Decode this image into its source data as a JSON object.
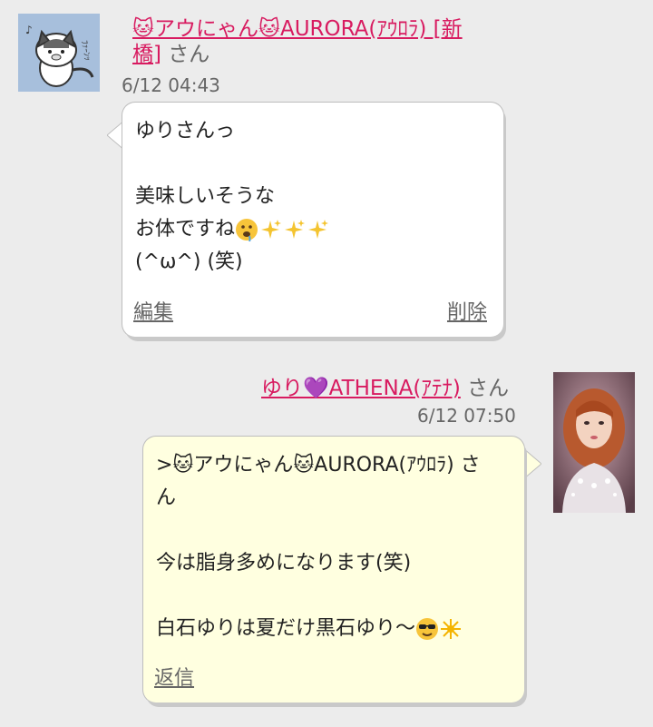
{
  "messages": [
    {
      "sender_name": "🐱アウにゃん🐱AURORA(ｱｳﾛﾗ) [新橋]",
      "sender_suffix": "さん",
      "timestamp": "6/12 04:43",
      "body_lines": [
        "ゆりさんっ",
        "",
        "美味しいそうな",
        "お体ですね",
        "(^ω^) (笑)"
      ],
      "inline_emojis": [
        "drooling-face",
        "sparkles",
        "sparkles",
        "sparkles"
      ],
      "actions": {
        "edit": "編集",
        "delete": "削除"
      }
    },
    {
      "sender_name": "ゆり💜ATHENA(ｱﾃﾅ)",
      "sender_suffix": "さん",
      "timestamp": "6/12 07:50",
      "body_lines": [
        ">🐱アウにゃん🐱AURORA(ｱｳﾛﾗ) さ",
        "ん",
        "",
        "今は脂身多めになります(笑)",
        "",
        "白石ゆりは夏だけ黒石ゆり〜"
      ],
      "inline_emojis": [
        "sunglasses-face",
        "sparkle-burst"
      ],
      "actions": {
        "reply": "返信"
      }
    }
  ],
  "colors": {
    "name_link": "#d81b60",
    "incoming_bubble": "#ffffff",
    "outgoing_bubble": "#ffffe0",
    "background": "#ececec"
  }
}
